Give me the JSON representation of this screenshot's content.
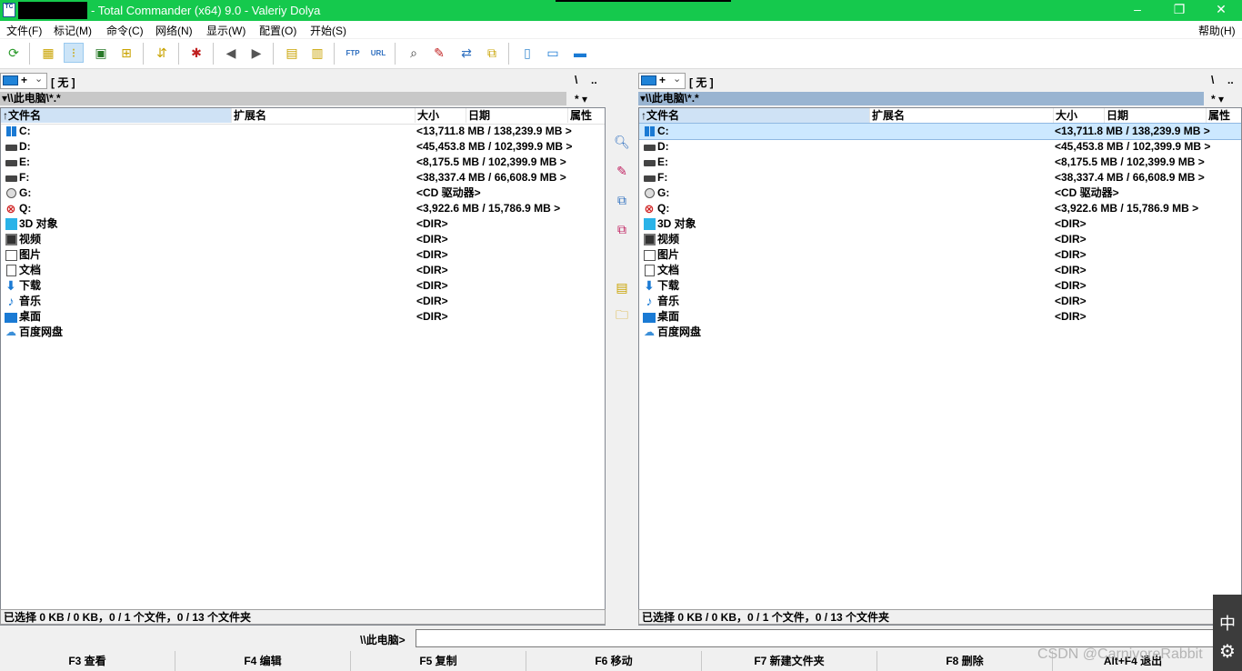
{
  "window": {
    "title": "- Total Commander (x64) 9.0 - Valeriy Dolya",
    "app_icon_text": "TC",
    "controls": [
      "–",
      "❐",
      "✕"
    ]
  },
  "menu": {
    "items": [
      "文件(F)",
      "标记(M)",
      "命令(C)",
      "网络(N)",
      "显示(W)",
      "配置(O)",
      "开始(S)"
    ],
    "help": "帮助(H)"
  },
  "toolbar": {
    "icons": [
      "refresh-icon",
      "brief-view-icon",
      "full-view-icon",
      "thumbnail-view-icon",
      "tree-view-icon",
      "invert-selection-icon",
      "unpack-icon",
      "back-icon",
      "forward-icon",
      "pack-icon",
      "unpack-files-icon",
      "ftp-icon",
      "url-icon",
      "search-icon",
      "multi-rename-icon",
      "sync-dirs-icon",
      "copy-names-icon",
      "notepad-icon",
      "monitor-icon",
      "desktop-icon"
    ]
  },
  "left_panel": {
    "drive_plus": "+",
    "drive_label": "[ 无 ]",
    "root_button": "\\",
    "up_button": "..",
    "path": "▾\\\\此电脑\\*.*",
    "filter": "*  ▾",
    "headers": {
      "name": "↑文件名",
      "ext": "扩展名",
      "size": "大小",
      "date": "日期",
      "attr": "属性"
    },
    "status": "已选择 0 KB / 0 KB，0 / 1 个文件，0 / 13 个文件夹"
  },
  "right_panel": {
    "drive_plus": "+",
    "drive_label": "[ 无 ]",
    "root_button": "\\",
    "up_button": "..",
    "path": "▾\\\\此电脑\\*.*",
    "filter": "*  ▾",
    "headers": {
      "name": "↑文件名",
      "ext": "扩展名",
      "size": "大小",
      "date": "日期",
      "attr": "属性"
    },
    "status": "已选择 0 KB / 0 KB，0 / 1 个文件，0 / 13 个文件夹"
  },
  "rows": [
    {
      "icon": "windows-drive-icon",
      "name": "C:",
      "size": "<13,711.8 MB / 138,239.9 MB >"
    },
    {
      "icon": "drive-icon",
      "name": "D:",
      "size": "<45,453.8 MB / 102,399.9 MB >"
    },
    {
      "icon": "drive-icon",
      "name": "E:",
      "size": "<8,175.5 MB / 102,399.9 MB >"
    },
    {
      "icon": "drive-icon",
      "name": "F:",
      "size": "<38,337.4 MB / 66,608.9 MB >"
    },
    {
      "icon": "cd-drive-icon",
      "name": "G:",
      "size": "<CD 驱动器>"
    },
    {
      "icon": "network-drive-icon",
      "name": "Q:",
      "size": "<3,922.6 MB / 15,786.9 MB >"
    },
    {
      "icon": "3d-objects-icon",
      "name": "3D 对象",
      "size": "<DIR>"
    },
    {
      "icon": "video-folder-icon",
      "name": "视频",
      "size": "<DIR>"
    },
    {
      "icon": "pictures-folder-icon",
      "name": "图片",
      "size": "<DIR>"
    },
    {
      "icon": "documents-folder-icon",
      "name": "文档",
      "size": "<DIR>"
    },
    {
      "icon": "downloads-folder-icon",
      "name": "下载",
      "size": "<DIR>"
    },
    {
      "icon": "music-folder-icon",
      "name": "音乐",
      "size": "<DIR>"
    },
    {
      "icon": "desktop-folder-icon",
      "name": "桌面",
      "size": "<DIR>"
    },
    {
      "icon": "baidu-netdisk-icon",
      "name": "百度网盘",
      "size": ""
    }
  ],
  "command": {
    "label": "\\\\此电脑>"
  },
  "fkeys": [
    "F3 查看",
    "F4 编辑",
    "F5 复制",
    "F6 移动",
    "F7 新建文件夹",
    "F8 删除",
    "Alt+F4 退出"
  ],
  "ime": {
    "mode": "中",
    "gear": "⚙"
  },
  "watermark": "CSDN @CarnivoreRabbit"
}
